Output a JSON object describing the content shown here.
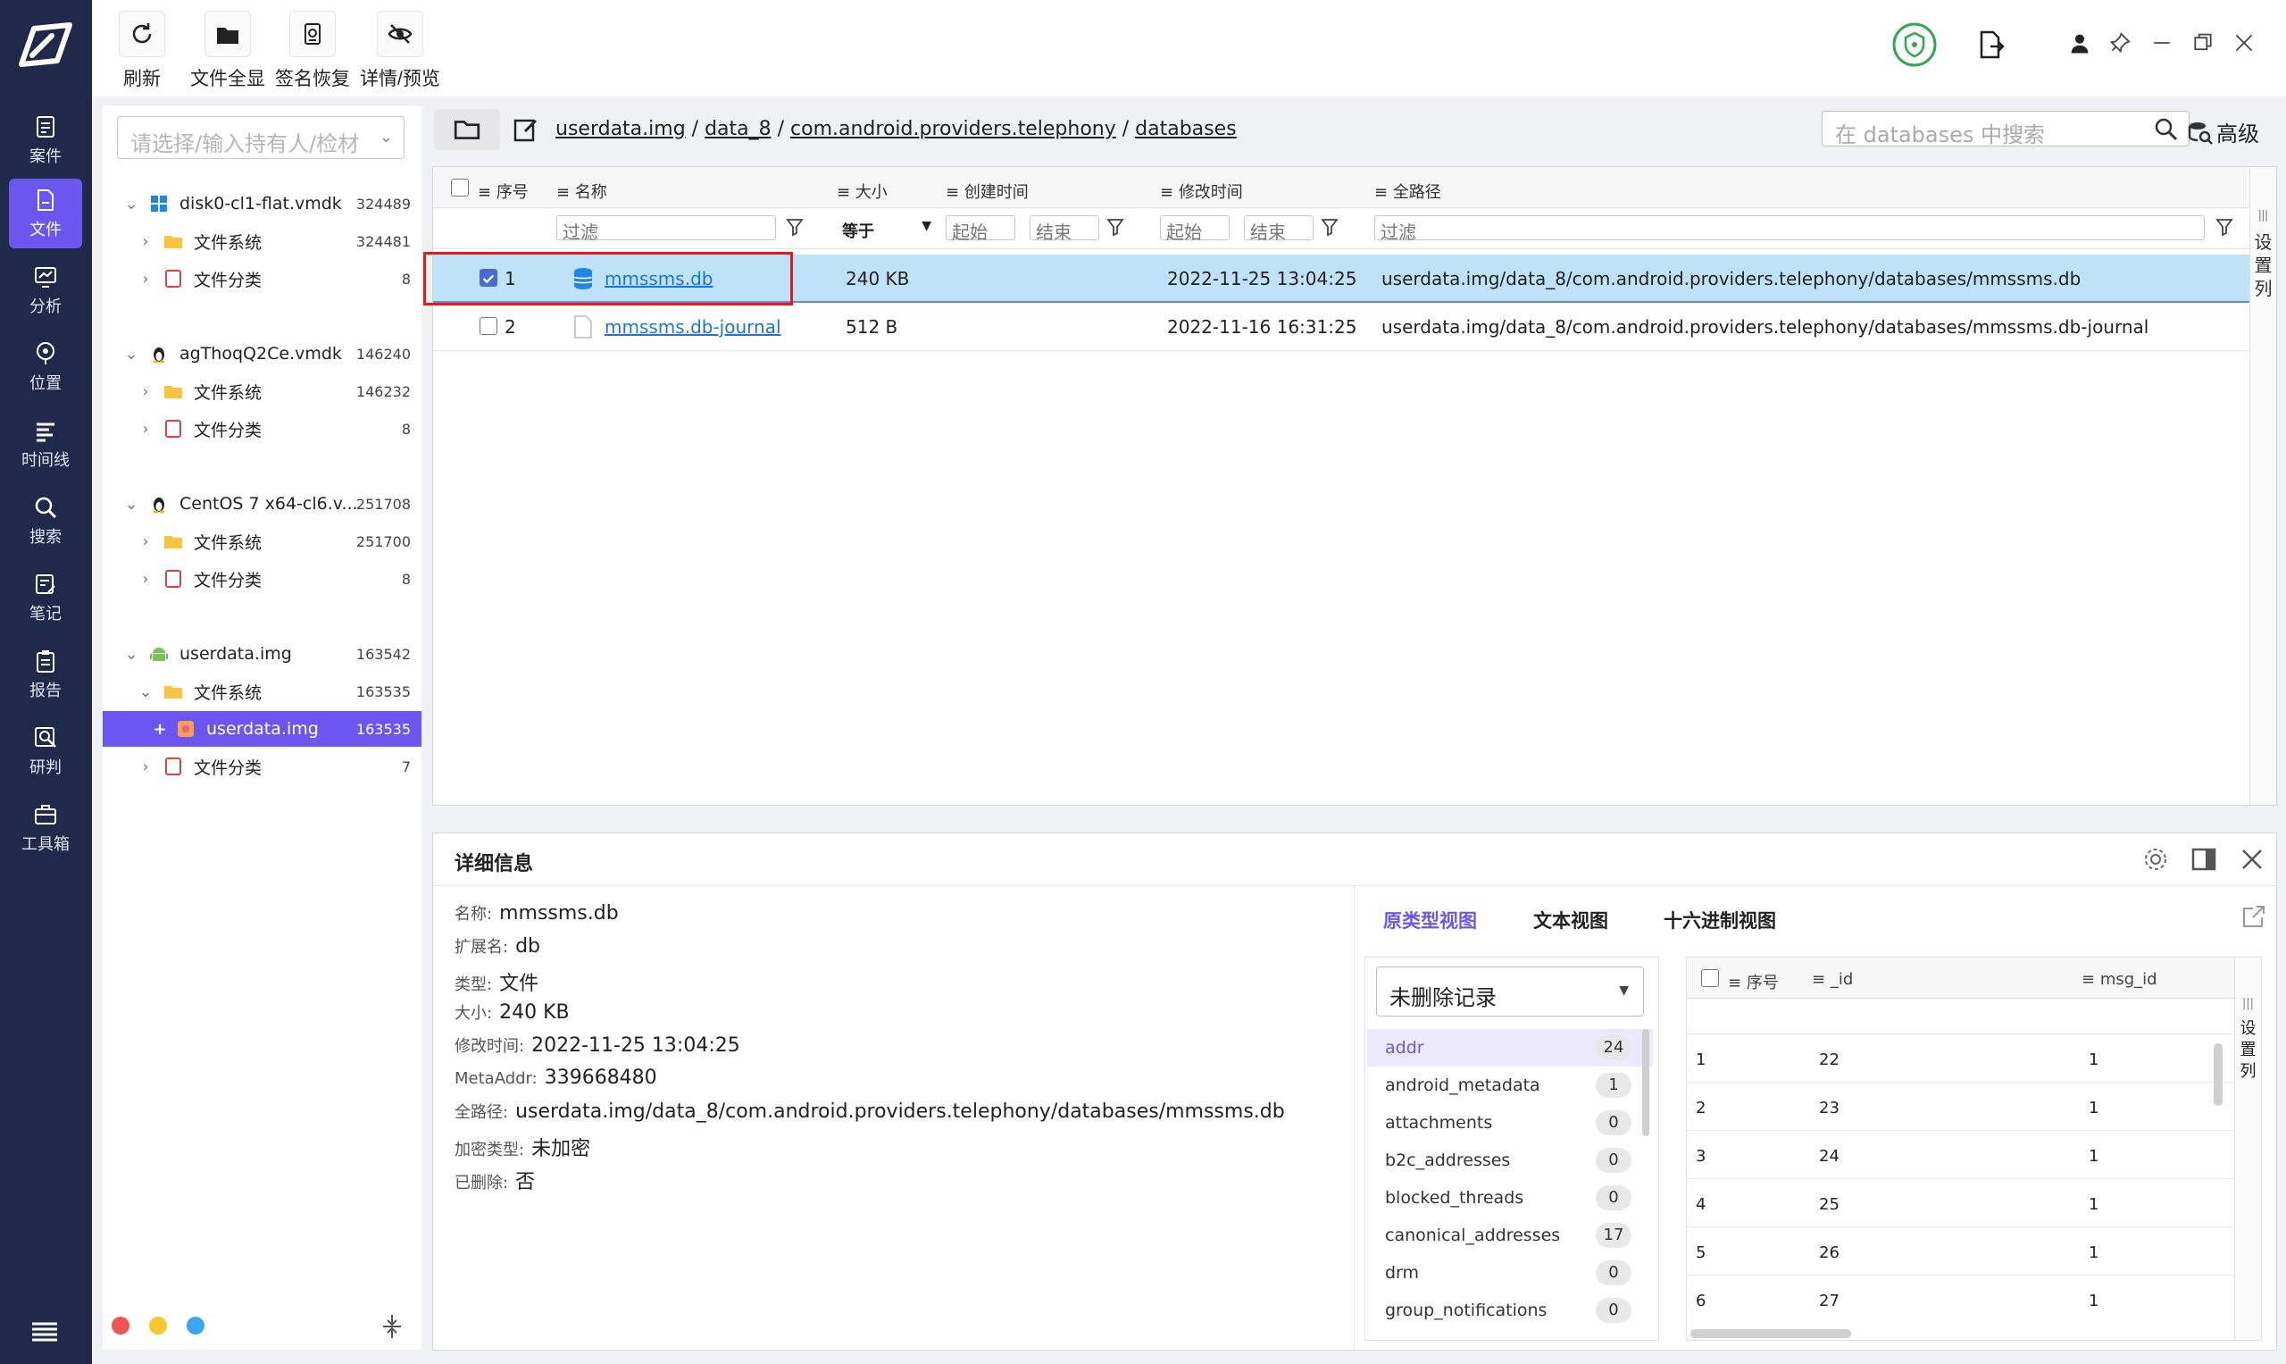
{
  "toolbar": {
    "buttons": [
      {
        "label": "刷新",
        "icon": "refresh-icon"
      },
      {
        "label": "文件全显",
        "icon": "folder-icon"
      },
      {
        "label": "签名恢复",
        "icon": "signature-icon"
      },
      {
        "label": "详情/预览",
        "icon": "eye-off-icon"
      }
    ]
  },
  "nav": {
    "items": [
      {
        "label": "案件",
        "icon": "case-icon"
      },
      {
        "label": "文件",
        "icon": "file-icon"
      },
      {
        "label": "分析",
        "icon": "analysis-icon"
      },
      {
        "label": "位置",
        "icon": "location-icon"
      },
      {
        "label": "时间线",
        "icon": "timeline-icon"
      },
      {
        "label": "搜索",
        "icon": "search-icon"
      },
      {
        "label": "笔记",
        "icon": "note-icon"
      },
      {
        "label": "报告",
        "icon": "report-icon"
      },
      {
        "label": "研判",
        "icon": "judge-icon"
      },
      {
        "label": "工具箱",
        "icon": "toolbox-icon"
      }
    ]
  },
  "tree": {
    "holder_placeholder": "请选择/输入持有人/检材",
    "nodes": [
      {
        "label": "disk0-cl1-flat.vmdk",
        "count": "324489"
      },
      {
        "label": "文件系统",
        "count": "324481"
      },
      {
        "label": "文件分类",
        "count": "8"
      },
      {
        "label": "agThoqQ2Ce.vmdk",
        "count": "146240"
      },
      {
        "label": "文件系统",
        "count": "146232"
      },
      {
        "label": "文件分类",
        "count": "8"
      },
      {
        "label": "CentOS 7 x64-cl6.v...",
        "count": "251708"
      },
      {
        "label": "文件系统",
        "count": "251700"
      },
      {
        "label": "文件分类",
        "count": "8"
      },
      {
        "label": "userdata.img",
        "count": "163542"
      },
      {
        "label": "文件系统",
        "count": "163535"
      },
      {
        "label": "userdata.img",
        "count": "163535"
      },
      {
        "label": "文件分类",
        "count": "7"
      }
    ]
  },
  "path": {
    "crumbs": [
      "userdata.img",
      "data_8",
      "com.android.providers.telephony",
      "databases"
    ],
    "search_placeholder": "在 databases 中搜索",
    "advanced": "高级"
  },
  "list": {
    "headers": [
      "序号",
      "名称",
      "大小",
      "创建时间",
      "修改时间",
      "全路径"
    ],
    "filter": {
      "text": "过滤",
      "equal": "等于",
      "start": "起始",
      "end": "结束"
    },
    "side": "设置列",
    "rows": [
      {
        "no": "1",
        "name": "mmssms.db",
        "size": "240 KB",
        "created": "",
        "modified": "2022-11-25 13:04:25",
        "path": "userdata.img/data_8/com.android.providers.telephony/databases/mmssms.db"
      },
      {
        "no": "2",
        "name": "mmssms.db-journal",
        "size": "512 B",
        "created": "",
        "modified": "2022-11-16 16:31:25",
        "path": "userdata.img/data_8/com.android.providers.telephony/databases/mmssms.db-journal"
      }
    ]
  },
  "detail": {
    "title": "详细信息",
    "props": [
      {
        "k": "名称:",
        "v": "mmssms.db"
      },
      {
        "k": "扩展名:",
        "v": "db"
      },
      {
        "k": "类型:",
        "v": "文件"
      },
      {
        "k": "大小:",
        "v": "240 KB"
      },
      {
        "k": "修改时间:",
        "v": "2022-11-25 13:04:25"
      },
      {
        "k": "MetaAddr:",
        "v": "339668480"
      },
      {
        "k": "全路径:",
        "v": "userdata.img/data_8/com.android.providers.telephony/databases/mmssms.db"
      },
      {
        "k": "加密类型:",
        "v": "未加密"
      },
      {
        "k": "已删除:",
        "v": "否"
      }
    ],
    "tabs": [
      "原类型视图",
      "文本视图",
      "十六进制视图"
    ],
    "record_select": "未删除记录",
    "tables": [
      {
        "name": "addr",
        "count": "24"
      },
      {
        "name": "android_metadata",
        "count": "1"
      },
      {
        "name": "attachments",
        "count": "0"
      },
      {
        "name": "b2c_addresses",
        "count": "0"
      },
      {
        "name": "blocked_threads",
        "count": "0"
      },
      {
        "name": "canonical_addresses",
        "count": "17"
      },
      {
        "name": "drm",
        "count": "0"
      },
      {
        "name": "group_notifications",
        "count": "0"
      }
    ],
    "grid": {
      "headers": [
        "序号",
        "_id",
        "msg_id"
      ],
      "side": "设置列",
      "rows": [
        [
          "1",
          "22",
          "1"
        ],
        [
          "2",
          "23",
          "1"
        ],
        [
          "3",
          "24",
          "1"
        ],
        [
          "4",
          "25",
          "1"
        ],
        [
          "5",
          "26",
          "1"
        ],
        [
          "6",
          "27",
          "1"
        ]
      ]
    }
  },
  "colors": {
    "accent": "#6b56f0",
    "nav_bg": "#1f2a4a",
    "selected_row": "#bee3f8",
    "highlight": "#e51b1b"
  }
}
